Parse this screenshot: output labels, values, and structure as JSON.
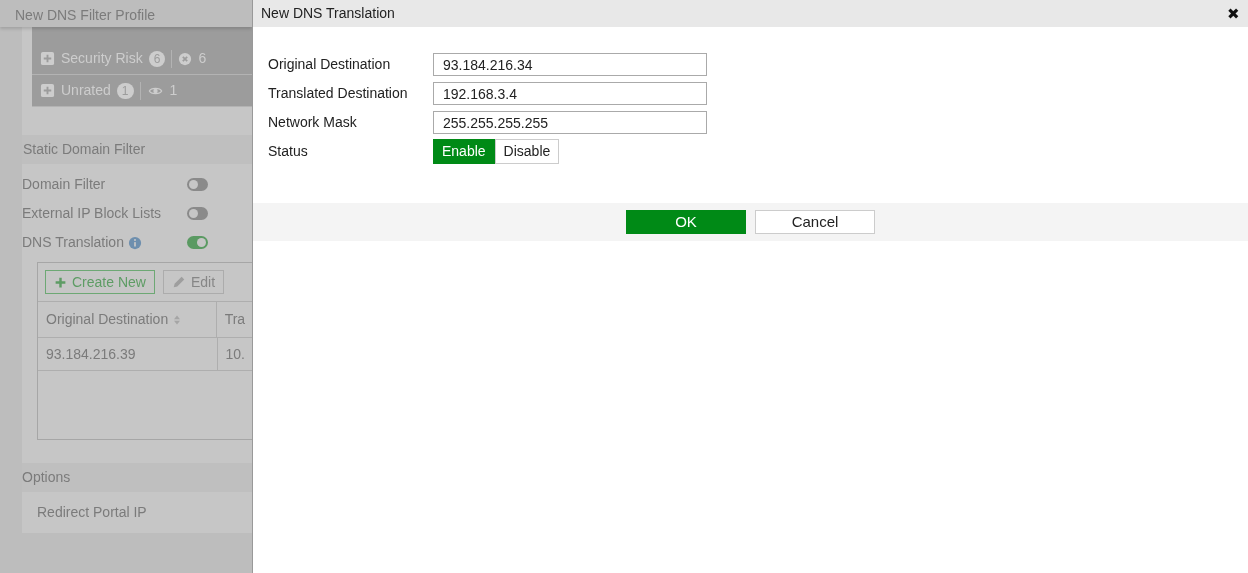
{
  "background_page": {
    "title": "New DNS Filter Profile",
    "categories": [
      {
        "label": "Security Risk",
        "count": "6",
        "action_count": "6",
        "kind": "block"
      },
      {
        "label": "Unrated",
        "count": "1",
        "action_count": "1",
        "kind": "monitor"
      }
    ],
    "static_domain_filter": {
      "heading": "Static Domain Filter",
      "toggles": [
        {
          "label": "Domain Filter",
          "on": false,
          "info": false
        },
        {
          "label": "External IP Block Lists",
          "on": false,
          "info": false
        },
        {
          "label": "DNS Translation",
          "on": true,
          "info": true
        }
      ],
      "toolbar": [
        {
          "label": "Create New",
          "kind": "create",
          "disabled": false
        },
        {
          "label": "Edit",
          "kind": "edit",
          "disabled": true
        }
      ],
      "table": {
        "columns": [
          "Original Destination",
          "Tra"
        ],
        "rows": [
          [
            "93.184.216.39",
            "10."
          ]
        ]
      }
    },
    "options": {
      "heading": "Options",
      "items": [
        "Redirect Portal IP"
      ]
    }
  },
  "dialog": {
    "title": "New DNS Translation",
    "close": "✖",
    "fields": [
      {
        "label": "Original Destination",
        "value": "93.184.216.34"
      },
      {
        "label": "Translated Destination",
        "value": "192.168.3.4"
      },
      {
        "label": "Network Mask",
        "value": "255.255.255.255"
      }
    ],
    "status": {
      "label": "Status",
      "options": [
        {
          "label": "Enable",
          "selected": true
        },
        {
          "label": "Disable",
          "selected": false
        }
      ]
    },
    "buttons": [
      {
        "label": "OK",
        "kind": "primary"
      },
      {
        "label": "Cancel",
        "kind": "secondary"
      }
    ]
  }
}
